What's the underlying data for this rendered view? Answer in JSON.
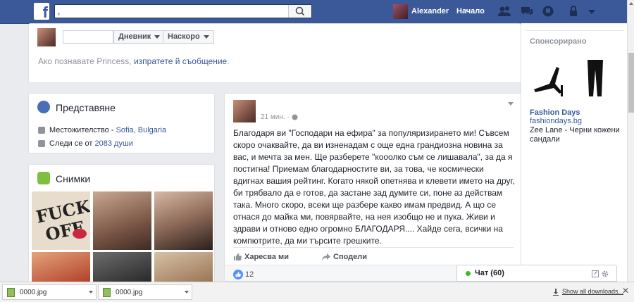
{
  "topbar": {
    "logo": "f",
    "search_value": ",",
    "user_name": "Alexander",
    "home_label": "Начало"
  },
  "profile_header": {
    "timeline_label": "Дневник",
    "recent_label": "Наскоро",
    "message_prefix": "Ако познавате Princess, ",
    "message_link": "изпратете й съобщение",
    "message_suffix": "."
  },
  "intro": {
    "title": "Представяне",
    "location_prefix": "Местожителство - ",
    "location_link": "Sofia, Bulgaria",
    "followers_prefix": "Следи се от ",
    "followers_link": "2083 души"
  },
  "photos": {
    "title": "Снимки"
  },
  "post": {
    "time": "21 мин. · ",
    "text": "Благодаря ви \"Господари на ефира\" за популяризирането ми! Съвсем скоро очаквайте, да ви изненадам с още една грандиозна новина за вас, и мечта за мен. Ще разберете \"кооолко съм се лишавала\", за да я постигна! Приемам благодарностите ви, за това, че космически вдигнах вашия рейтинг. Когато някой опетнява и клевети името на друг, би трябвало да е готов, да застане зад думите си, поне аз действам така. Много скоро, всеки ще разбере какво имам предвид. А що се отнася до майка ми, повярвайте, на нея изобщо не и пука. Живи и здрави и отново едно огромно БЛАГОДАРЯ.... Хайде сега, всички на компютрите, да ми търсите грешките.",
    "like_label": "Харесва ми",
    "share_label": "Сподели",
    "likes_count": "12"
  },
  "sidebar": {
    "sponsored_label": "Спонсорирано",
    "ad_title": "Fashion Days",
    "ad_url": "fashiondays.bg",
    "ad_desc": "Zee Lane - Черни кожени сандали"
  },
  "chat": {
    "label": "Чат (60)"
  },
  "downloads": {
    "items": [
      {
        "name": "0000.jpg"
      },
      {
        "name": "0000.jpg"
      }
    ],
    "show_all": "Show all downloads..."
  },
  "colors": {
    "facebook_blue": "#3b5998",
    "link_blue": "#365899",
    "online_green": "#42b72a"
  }
}
